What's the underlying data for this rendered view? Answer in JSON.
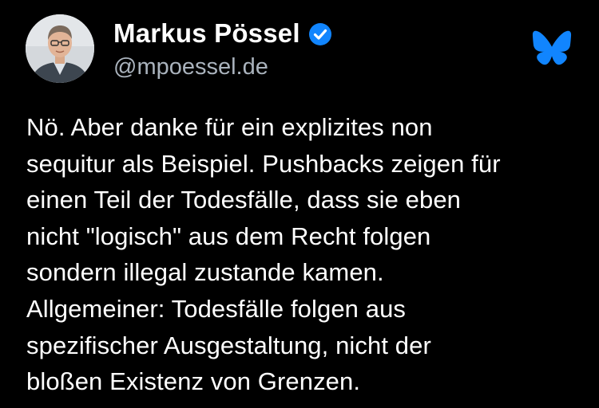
{
  "author": {
    "display_name": "Markus Pössel",
    "handle": "@mpoessel.de",
    "verified": true
  },
  "icons": {
    "avatar": "profile-photo",
    "verified": "verified-badge-icon",
    "brand": "butterfly-logo-icon"
  },
  "colors": {
    "background": "#000000",
    "text": "#ffffff",
    "handle": "#aab3bd",
    "accent": "#1185fe"
  },
  "post": {
    "lines": [
      "Nö. Aber danke für ein explizites non",
      "sequitur als Beispiel. Pushbacks zeigen für",
      "einen Teil der Todesfälle, dass sie eben",
      "nicht \"logisch\" aus dem Recht folgen",
      "sondern illegal zustande kamen.",
      "Allgemeiner: Todesfälle folgen aus",
      "spezifischer Ausgestaltung, nicht der",
      "bloßen Existenz von Grenzen."
    ]
  }
}
